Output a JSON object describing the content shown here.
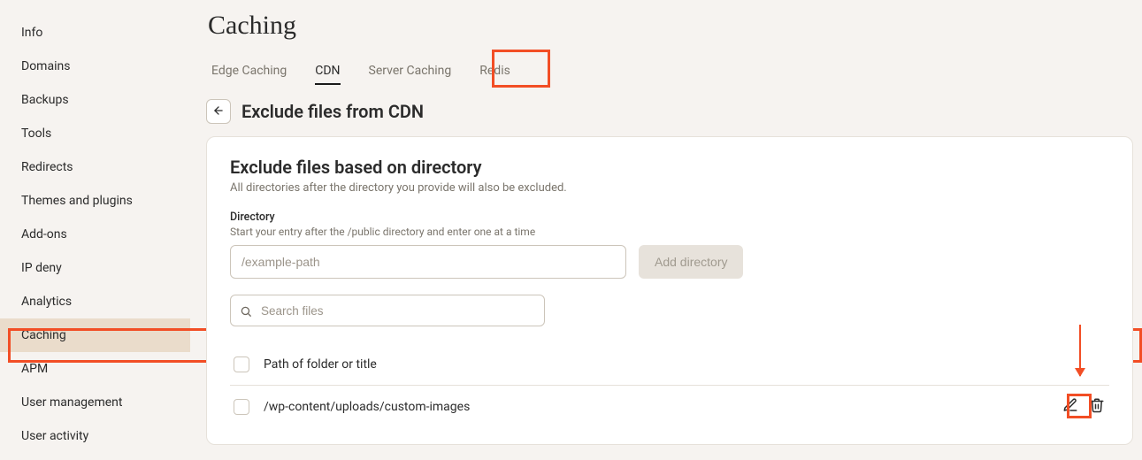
{
  "sidebar": {
    "items": [
      {
        "label": "Info"
      },
      {
        "label": "Domains"
      },
      {
        "label": "Backups"
      },
      {
        "label": "Tools"
      },
      {
        "label": "Redirects"
      },
      {
        "label": "Themes and plugins"
      },
      {
        "label": "Add-ons"
      },
      {
        "label": "IP deny"
      },
      {
        "label": "Analytics"
      },
      {
        "label": "Caching"
      },
      {
        "label": "APM"
      },
      {
        "label": "User management"
      },
      {
        "label": "User activity"
      }
    ],
    "active_index": 9
  },
  "page_title": "Caching",
  "tabs": {
    "items": [
      {
        "label": "Edge Caching"
      },
      {
        "label": "CDN"
      },
      {
        "label": "Server Caching"
      },
      {
        "label": "Redis"
      }
    ],
    "active_index": 1
  },
  "subheader_title": "Exclude files from CDN",
  "section": {
    "title": "Exclude files based on directory",
    "description": "All directories after the directory you provide will also be excluded.",
    "field_label": "Directory",
    "field_help": "Start your entry after the /public directory and enter one at a time",
    "input_placeholder": "/example-path",
    "add_button_label": "Add directory",
    "search_placeholder": "Search files",
    "header_label": "Path of folder or title",
    "rows": [
      {
        "path": "/wp-content/uploads/custom-images"
      }
    ]
  }
}
